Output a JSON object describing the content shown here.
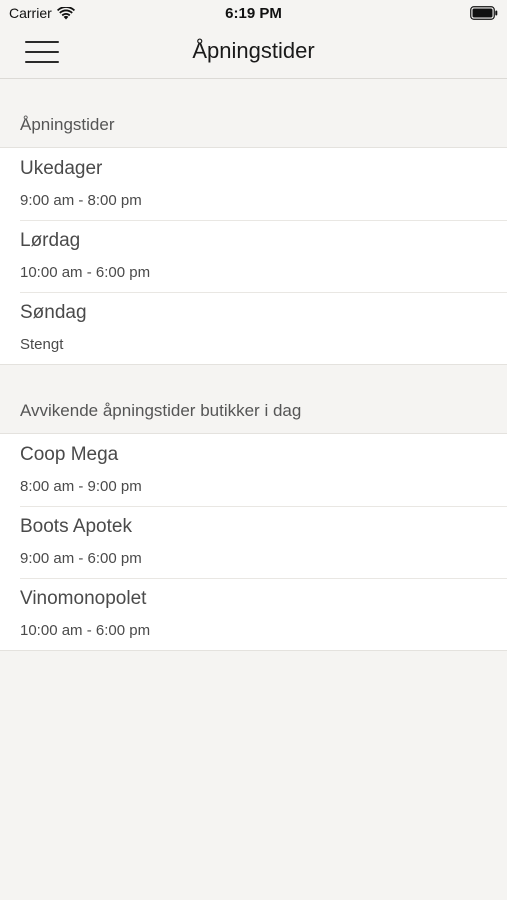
{
  "status_bar": {
    "carrier": "Carrier",
    "time": "6:19 PM",
    "icons": [
      "wifi-icon",
      "battery-icon"
    ]
  },
  "nav": {
    "title": "Åpningstider",
    "menu_icon": "hamburger-menu-icon"
  },
  "sections": [
    {
      "header": "Åpningstider",
      "rows": [
        {
          "title": "Ukedager",
          "subtitle": "9:00 am - 8:00 pm"
        },
        {
          "title": "Lørdag",
          "subtitle": "10:00 am - 6:00 pm"
        },
        {
          "title": "Søndag",
          "subtitle": "Stengt"
        }
      ]
    },
    {
      "header": "Avvikende åpningstider butikker i dag",
      "rows": [
        {
          "title": "Coop Mega",
          "subtitle": "8:00 am - 9:00 pm"
        },
        {
          "title": "Boots Apotek",
          "subtitle": "9:00 am - 6:00 pm"
        },
        {
          "title": "Vinomonopolet",
          "subtitle": "10:00 am - 6:00 pm"
        }
      ]
    }
  ],
  "colors": {
    "background": "#f5f4f2",
    "row_background": "#ffffff",
    "text": "#4a4a4a"
  }
}
